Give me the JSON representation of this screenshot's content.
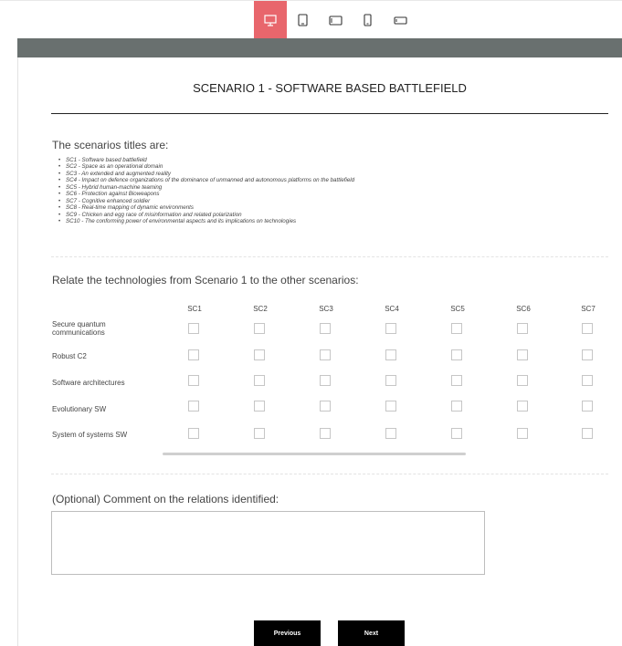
{
  "devices": [
    {
      "name": "desktop",
      "active": true
    },
    {
      "name": "tablet-portrait",
      "active": false
    },
    {
      "name": "tablet-landscape",
      "active": false
    },
    {
      "name": "phone-portrait",
      "active": false
    },
    {
      "name": "phone-landscape",
      "active": false
    }
  ],
  "colors": {
    "accent": "#e8666c",
    "header_bar": "#69706f",
    "button_bg": "#000000"
  },
  "page": {
    "title": "SCENARIO 1 - SOFTWARE BASED BATTLEFIELD"
  },
  "scenarios": {
    "heading": "The scenarios titles are:",
    "items": [
      "SC1 - Software based battlefield",
      "SC2 - Space as an operational domain",
      "SC3 - An extended and augmented reality",
      "SC4 - Impact on defence organizations of the dominance of unmanned and autonomous platforms on the battlefield",
      "SC5 - Hybrid human-machine teaming",
      "SC6 - Protection against Bioweapons",
      "SC7 - Cognitive enhanced soldier",
      "SC8 - Real-time mapping of dynamic environments",
      "SC9 - Chicken and egg race of misinformation and related polarization",
      "SC10 - The conforming power of environmental aspects and its implications on technologies"
    ]
  },
  "matrix": {
    "heading": "Relate the technologies from Scenario 1 to the other scenarios:",
    "columns": [
      "SC1",
      "SC2",
      "SC3",
      "SC4",
      "SC5",
      "SC6",
      "SC7"
    ],
    "rows": [
      {
        "label": "Secure quantum communications",
        "checked": [
          false,
          false,
          false,
          false,
          false,
          false,
          false
        ]
      },
      {
        "label": "Robust C2",
        "checked": [
          false,
          false,
          false,
          false,
          false,
          false,
          false
        ]
      },
      {
        "label": "Software architectures",
        "checked": [
          false,
          false,
          false,
          false,
          false,
          false,
          false
        ]
      },
      {
        "label": "Evolutionary SW",
        "checked": [
          false,
          false,
          false,
          false,
          false,
          false,
          false
        ]
      },
      {
        "label": "System of systems SW",
        "checked": [
          false,
          false,
          false,
          false,
          false,
          false,
          false
        ]
      }
    ]
  },
  "comment": {
    "heading": "(Optional) Comment on the relations identified:",
    "value": ""
  },
  "buttons": {
    "previous": "Previous",
    "next": "Next"
  }
}
